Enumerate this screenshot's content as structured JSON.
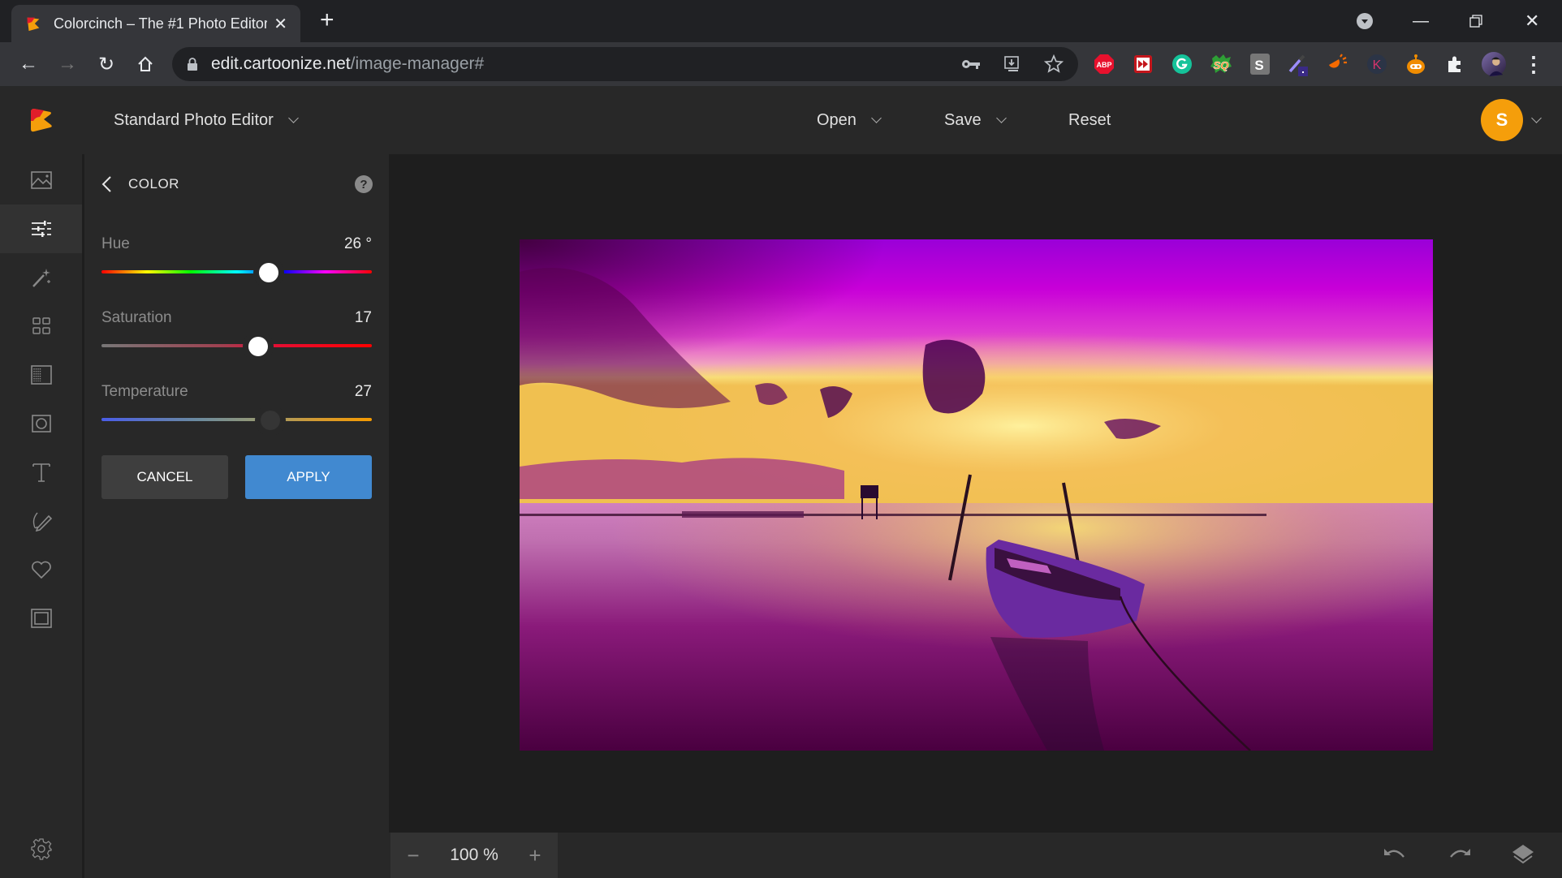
{
  "browser": {
    "tab_title": "Colorcinch – The #1 Photo Editor",
    "url_host": "edit.cartoonize.net",
    "url_path": "/image-manager#",
    "extensions": [
      "ABP",
      "video-speed",
      "Grammarly",
      "SQ",
      "S",
      "color-picker",
      "orange-ext",
      "K",
      "robot-ext",
      "puzzle-extensions",
      "profile-avatar"
    ]
  },
  "app": {
    "editor_mode": "Standard Photo Editor",
    "menu": {
      "open": "Open",
      "save": "Save",
      "reset": "Reset"
    },
    "user_initial": "S",
    "brand_color": "#f59e0b"
  },
  "sidebar": {
    "items": [
      {
        "name": "image",
        "active": false
      },
      {
        "name": "adjust",
        "active": true
      },
      {
        "name": "effects",
        "active": false
      },
      {
        "name": "filters",
        "active": false
      },
      {
        "name": "texture",
        "active": false
      },
      {
        "name": "mask",
        "active": false
      },
      {
        "name": "text",
        "active": false
      },
      {
        "name": "draw",
        "active": false
      },
      {
        "name": "graphics",
        "active": false
      },
      {
        "name": "frames",
        "active": false
      },
      {
        "name": "settings",
        "active": false
      }
    ]
  },
  "panel": {
    "title": "COLOR",
    "controls": [
      {
        "label": "Hue",
        "value": "26 °",
        "position": 0.62
      },
      {
        "label": "Saturation",
        "value": "17",
        "position": 0.58
      },
      {
        "label": "Temperature",
        "value": "27",
        "position": 0.625
      }
    ],
    "cancel_label": "CANCEL",
    "apply_label": "APPLY",
    "apply_color": "#4189d0"
  },
  "canvas": {
    "zoom_level": "100 %",
    "zoom_out": "−",
    "zoom_in": "+"
  }
}
